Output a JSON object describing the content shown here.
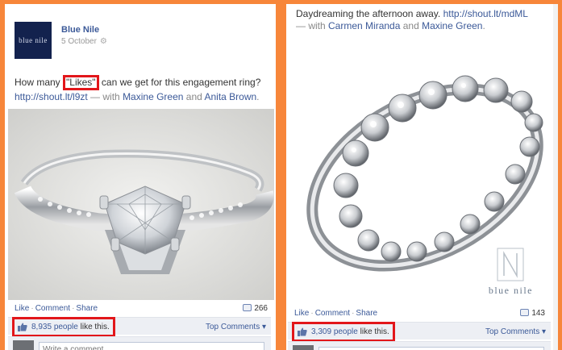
{
  "left_post": {
    "page_name": "Blue Nile",
    "date": "5 October",
    "avatar_text": "blue nile",
    "caption_pre": "How many ",
    "caption_highlight": "\"Likes\"",
    "caption_post": " can we get for this engagement ring?",
    "link": "http://shout.lt/l9zt",
    "with_text": " — with ",
    "tag_1": "Maxine Green",
    "and_text": " and ",
    "tag_2": "Anita Brown",
    "end_punct": ".",
    "actions": {
      "like": "Like",
      "comment": "Comment",
      "share": "Share",
      "sep": "·"
    },
    "comment_count": "266",
    "likes_count": "8,935",
    "likes_text": "people",
    "likes_suffix": "like this.",
    "top_comments": "Top Comments ▾",
    "comment_placeholder": "Write a comment..."
  },
  "right_post": {
    "caption_pre": "Daydreaming the afternoon away. ",
    "link": "http://shout.lt/mdML",
    "with_text": "— with ",
    "tag_1": "Carmen Miranda",
    "and_text": " and ",
    "tag_2": "Maxine Green",
    "end_punct": ".",
    "brand_text": "blue nile",
    "actions": {
      "like": "Like",
      "comment": "Comment",
      "share": "Share",
      "sep": "·"
    },
    "comment_count": "143",
    "likes_count": "3,309",
    "likes_text": "people",
    "likes_suffix": "like this.",
    "top_comments": "Top Comments ▾"
  },
  "colors": {
    "background": "#f7863a",
    "highlight": "#e2161a",
    "link": "#3b5998"
  }
}
